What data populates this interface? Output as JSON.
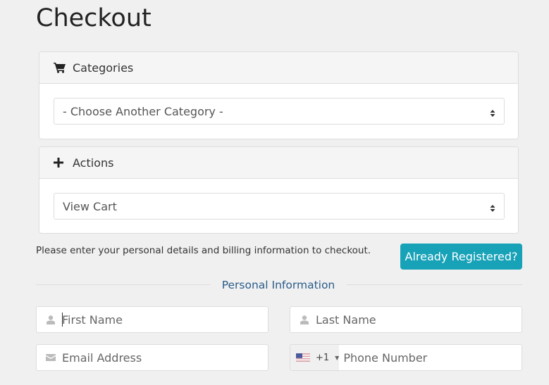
{
  "page": {
    "title": "Checkout"
  },
  "categories_panel": {
    "heading": "Categories",
    "icon": "shopping-cart-icon",
    "select_value": "- Choose Another Category -"
  },
  "actions_panel": {
    "heading": "Actions",
    "icon": "plus-icon",
    "select_value": "View Cart"
  },
  "intro": {
    "text": "Please enter your personal details and billing information to checkout.",
    "already_registered_label": "Already Registered?",
    "button_color": "#17a2b8"
  },
  "personal_info": {
    "section_title": "Personal Information",
    "first_name": {
      "placeholder": "First Name",
      "value": "",
      "icon": "user-icon"
    },
    "last_name": {
      "placeholder": "Last Name",
      "value": "",
      "icon": "user-icon"
    },
    "email": {
      "placeholder": "Email Address",
      "value": "",
      "icon": "envelope-icon"
    },
    "phone": {
      "placeholder": "Phone Number",
      "value": "",
      "country_flag": "us-flag-icon",
      "dial_code": "+1"
    }
  }
}
